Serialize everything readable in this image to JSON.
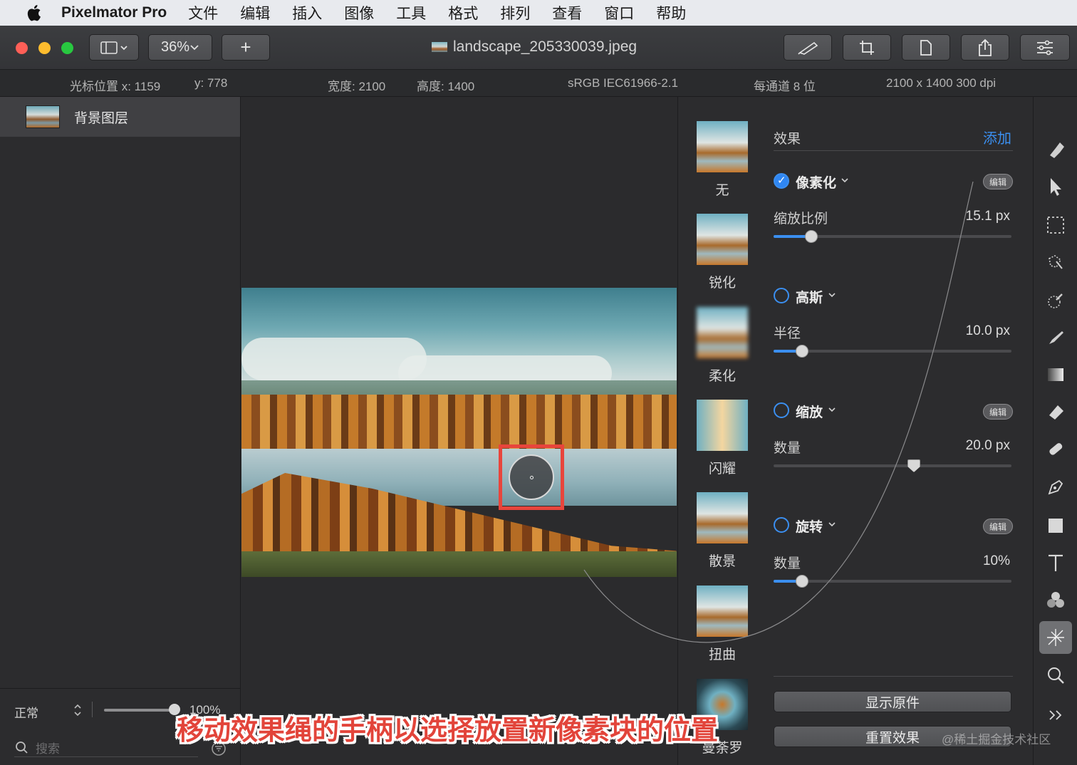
{
  "menubar": {
    "app_name": "Pixelmator Pro",
    "items": [
      "文件",
      "编辑",
      "插入",
      "图像",
      "工具",
      "格式",
      "排列",
      "查看",
      "窗口",
      "帮助"
    ]
  },
  "toolbar": {
    "zoom": "36%",
    "add_label": "+",
    "document_title": "landscape_205330039.jpeg"
  },
  "infobar": {
    "cursor_x": "光标位置 x:  1159",
    "cursor_y": "y:  778",
    "width": "宽度:  2100",
    "height": "高度:  1400",
    "color_profile": "sRGB IEC61966-2.1",
    "bit_depth": "每通道 8 位",
    "dimensions": "2100 x 1400 300 dpi"
  },
  "layers": {
    "items": [
      {
        "name": "背景图层"
      }
    ],
    "blend_mode": "正常",
    "opacity": "100%",
    "search_placeholder": "搜索"
  },
  "effect_presets": [
    "无",
    "锐化",
    "柔化",
    "闪耀",
    "散景",
    "扭曲",
    "曼荼罗"
  ],
  "effects": {
    "header": "效果",
    "add_label": "添加",
    "edit_label": "编辑",
    "items": [
      {
        "name": "像素化",
        "enabled": true,
        "param": "缩放比例",
        "value": "15.1 px",
        "level": 0.16
      },
      {
        "name": "高斯",
        "enabled": false,
        "param": "半径",
        "value": "10.0 px",
        "level": 0.12
      },
      {
        "name": "缩放",
        "enabled": false,
        "param": "数量",
        "value": "20.0 px",
        "level": 0.59
      },
      {
        "name": "旋转",
        "enabled": false,
        "param": "数量",
        "value": "10%",
        "level": 0.12
      }
    ],
    "show_original": "显示原件",
    "reset": "重置效果"
  },
  "tools": [
    "style-tool-icon",
    "arrange-tool-icon",
    "select-tool-icon",
    "quick-select-icon",
    "color-select-icon",
    "paint-tool-icon",
    "gradient-tool-icon",
    "erase-tool-icon",
    "retouch-tool-icon",
    "pen-tool-icon",
    "shape-tool-icon",
    "type-tool-icon",
    "color-adjust-icon",
    "effects-tool-icon",
    "zoom-tool-icon",
    "more-tools-icon"
  ],
  "caption": "移动效果绳的手柄以选择放置新像素块的位置",
  "watermark": "@稀土掘金技术社区",
  "colors": {
    "accent": "#2f86f2",
    "highlight": "#e8453c"
  }
}
